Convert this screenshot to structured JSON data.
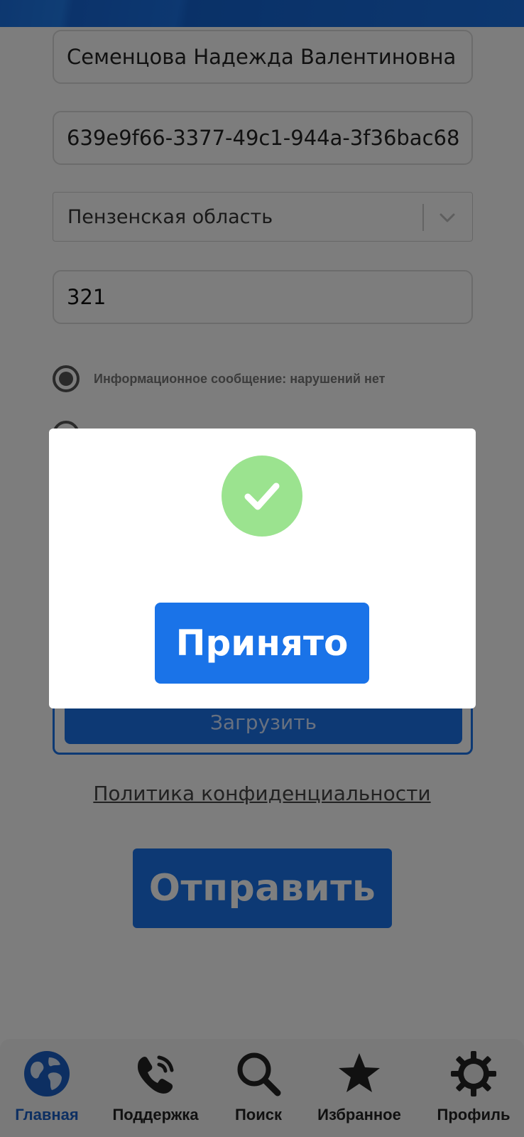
{
  "form": {
    "full_name": "Семенцова Надежда Валентиновна",
    "uuid": "639e9f66-3377-49c1-944a-3f36bac68",
    "region": "Пензенская область",
    "number": "321",
    "radio_option_1": "Информационное сообщение: нарушений нет",
    "upload_label": "Загрузить",
    "policy_link": "Политика конфиденциальности",
    "submit_label": "Отправить"
  },
  "modal": {
    "status_icon": "check-circle-icon",
    "accept_label": "Принято"
  },
  "bottom_nav": {
    "items": [
      {
        "label": "Главная",
        "icon": "globe-icon",
        "active": true
      },
      {
        "label": "Поддержка",
        "icon": "phone-icon",
        "active": false
      },
      {
        "label": "Поиск",
        "icon": "search-icon",
        "active": false
      },
      {
        "label": "Избранное",
        "icon": "star-icon",
        "active": false
      },
      {
        "label": "Профиль",
        "icon": "gear-icon",
        "active": false
      }
    ]
  },
  "colors": {
    "accent": "#1a73e8",
    "success": "#9be38f",
    "active_nav": "#1a5fc4"
  }
}
